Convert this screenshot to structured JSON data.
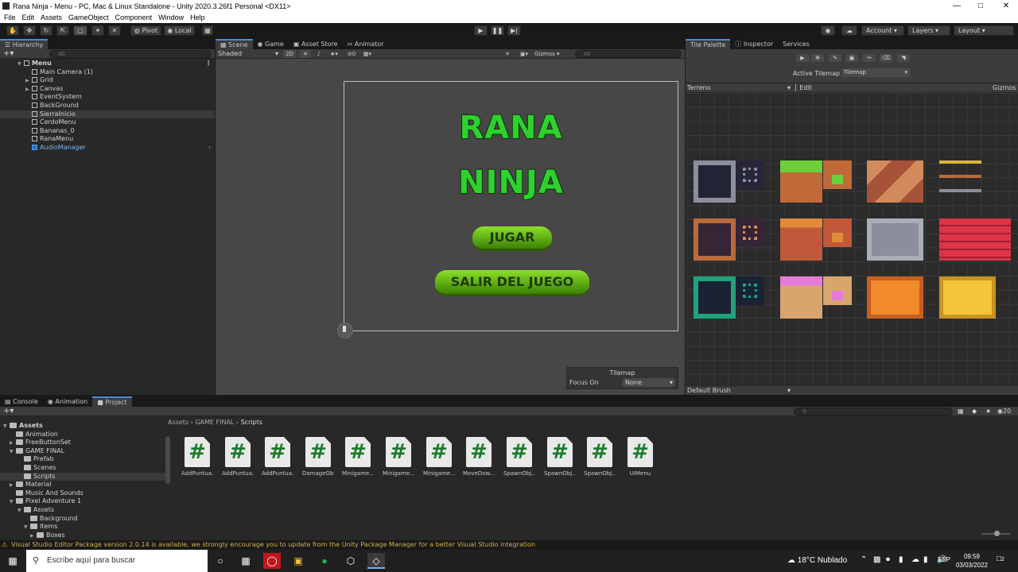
{
  "window": {
    "title": "Rana Ninja - Menu - PC, Mac & Linux Standalone - Unity 2020.3.26f1 Personal <DX11>"
  },
  "menu": [
    "File",
    "Edit",
    "Assets",
    "GameObject",
    "Component",
    "Window",
    "Help"
  ],
  "toolbar": {
    "pivot": "Pivot",
    "local": "Local",
    "account": "Account",
    "layers": "Layers",
    "layout": "Layout"
  },
  "hierarchy": {
    "tab": "Hierarchy",
    "search_placeholder": "All",
    "scene": "Menu",
    "items": [
      {
        "label": "Main Camera (1)"
      },
      {
        "label": "Grid"
      },
      {
        "label": "Canvas"
      },
      {
        "label": "EventSystem"
      },
      {
        "label": "BackGround"
      },
      {
        "label": "SierraInicio"
      },
      {
        "label": "CerdoMenu"
      },
      {
        "label": "Bananas_0"
      },
      {
        "label": "RanaMenu"
      },
      {
        "label": "AudioManager"
      }
    ]
  },
  "scene_view": {
    "tabs": [
      "Scene",
      "Game",
      "Asset Store",
      "Animator"
    ],
    "shading": "Shaded",
    "mode_2d": "2D",
    "gizmos": "Gizmos",
    "search_placeholder": "All",
    "fx_count": "0",
    "game_title_line1": "RANA",
    "game_title_line2": "NINJA",
    "button_play": "JUGAR",
    "button_exit": "SALIR DEL JUEGO",
    "overlay_title": "Tilemap",
    "overlay_label": "Focus On",
    "overlay_value": "None"
  },
  "tile_palette": {
    "tabs": [
      "Tile Palette",
      "Inspector",
      "Services"
    ],
    "active_tilemap_label": "Active Tilemap",
    "active_tilemap_value": "Tilemap",
    "palette": "Terreno",
    "edit": "Edit",
    "gizmos": "Gizmos",
    "brush": "Default Brush"
  },
  "bottom": {
    "tabs": [
      "Console",
      "Animation",
      "Project"
    ],
    "breadcrumb": [
      "Assets",
      "GAME FINAL",
      "Scripts"
    ],
    "visible_count": "20",
    "tree": [
      {
        "label": "Assets"
      },
      {
        "label": "Animation"
      },
      {
        "label": "FreeButtonSet"
      },
      {
        "label": "GAME FINAL"
      },
      {
        "label": "Prefab"
      },
      {
        "label": "Scenes"
      },
      {
        "label": "Scripts"
      },
      {
        "label": "Material"
      },
      {
        "label": "Music And Sounds"
      },
      {
        "label": "Pixel Adventure 1"
      },
      {
        "label": "Assets"
      },
      {
        "label": "Background"
      },
      {
        "label": "Items"
      },
      {
        "label": "Boxes"
      }
    ],
    "scripts": [
      "AddPuntua...",
      "AddPuntua...",
      "AddPuntua...",
      "DamageOb...",
      "Minigame...",
      "Minigame...",
      "Minigame...",
      "MoveDow...",
      "SpawnObj...",
      "SpawnObj...",
      "SpawnObj...",
      "UIMenu"
    ]
  },
  "status": "Visual Studio Editor Package version 2.0.14 is available, we strongly encourage you to update from the Unity Package Manager for a better Visual Studio integration",
  "taskbar": {
    "search_placeholder": "Escribe aquí para buscar",
    "weather": "18°C  Nublado",
    "lang": "ESP",
    "time": "09:59",
    "date": "03/03/2022",
    "notifications": "2"
  }
}
